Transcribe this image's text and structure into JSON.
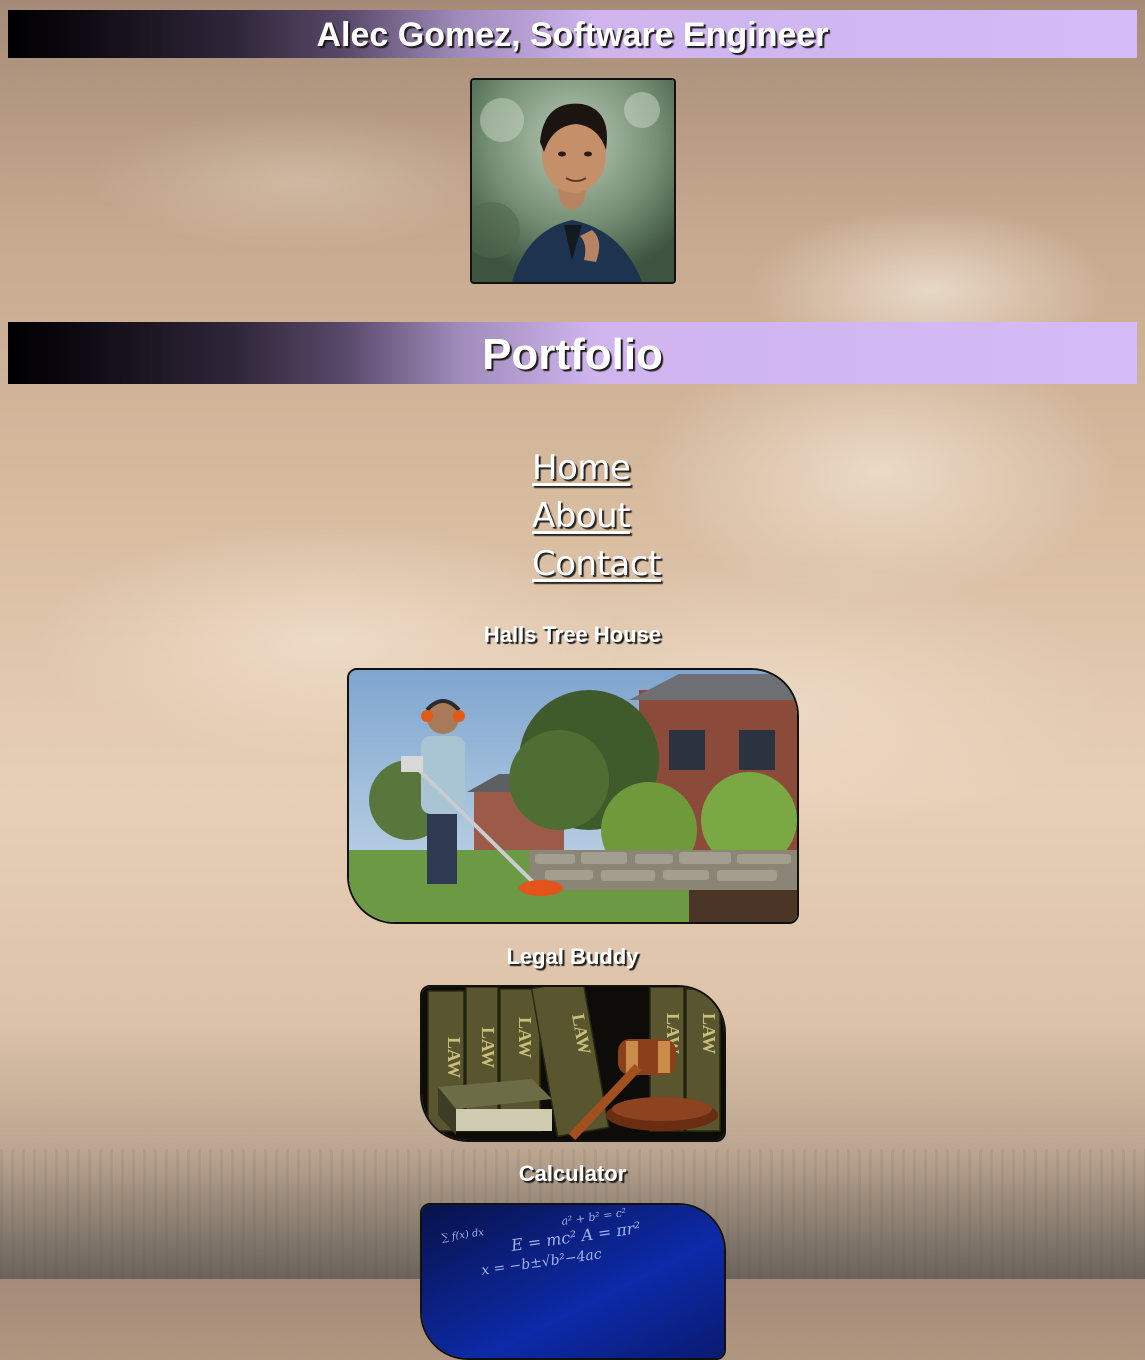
{
  "header": {
    "title": "Alec Gomez, Software Engineer"
  },
  "profile": {
    "alt": "Alec Gomez profile photo"
  },
  "section": {
    "title": "Portfolio"
  },
  "nav": {
    "items": [
      {
        "label": "Home"
      },
      {
        "label": "About"
      },
      {
        "label": "Contact"
      }
    ]
  },
  "projects": [
    {
      "title": "Halls Tree House"
    },
    {
      "title": "Legal Buddy"
    },
    {
      "title": "Calculator"
    }
  ],
  "colors": {
    "banner_start": "#000000",
    "banner_end": "#d4bbf7",
    "text": "#ffffff"
  }
}
